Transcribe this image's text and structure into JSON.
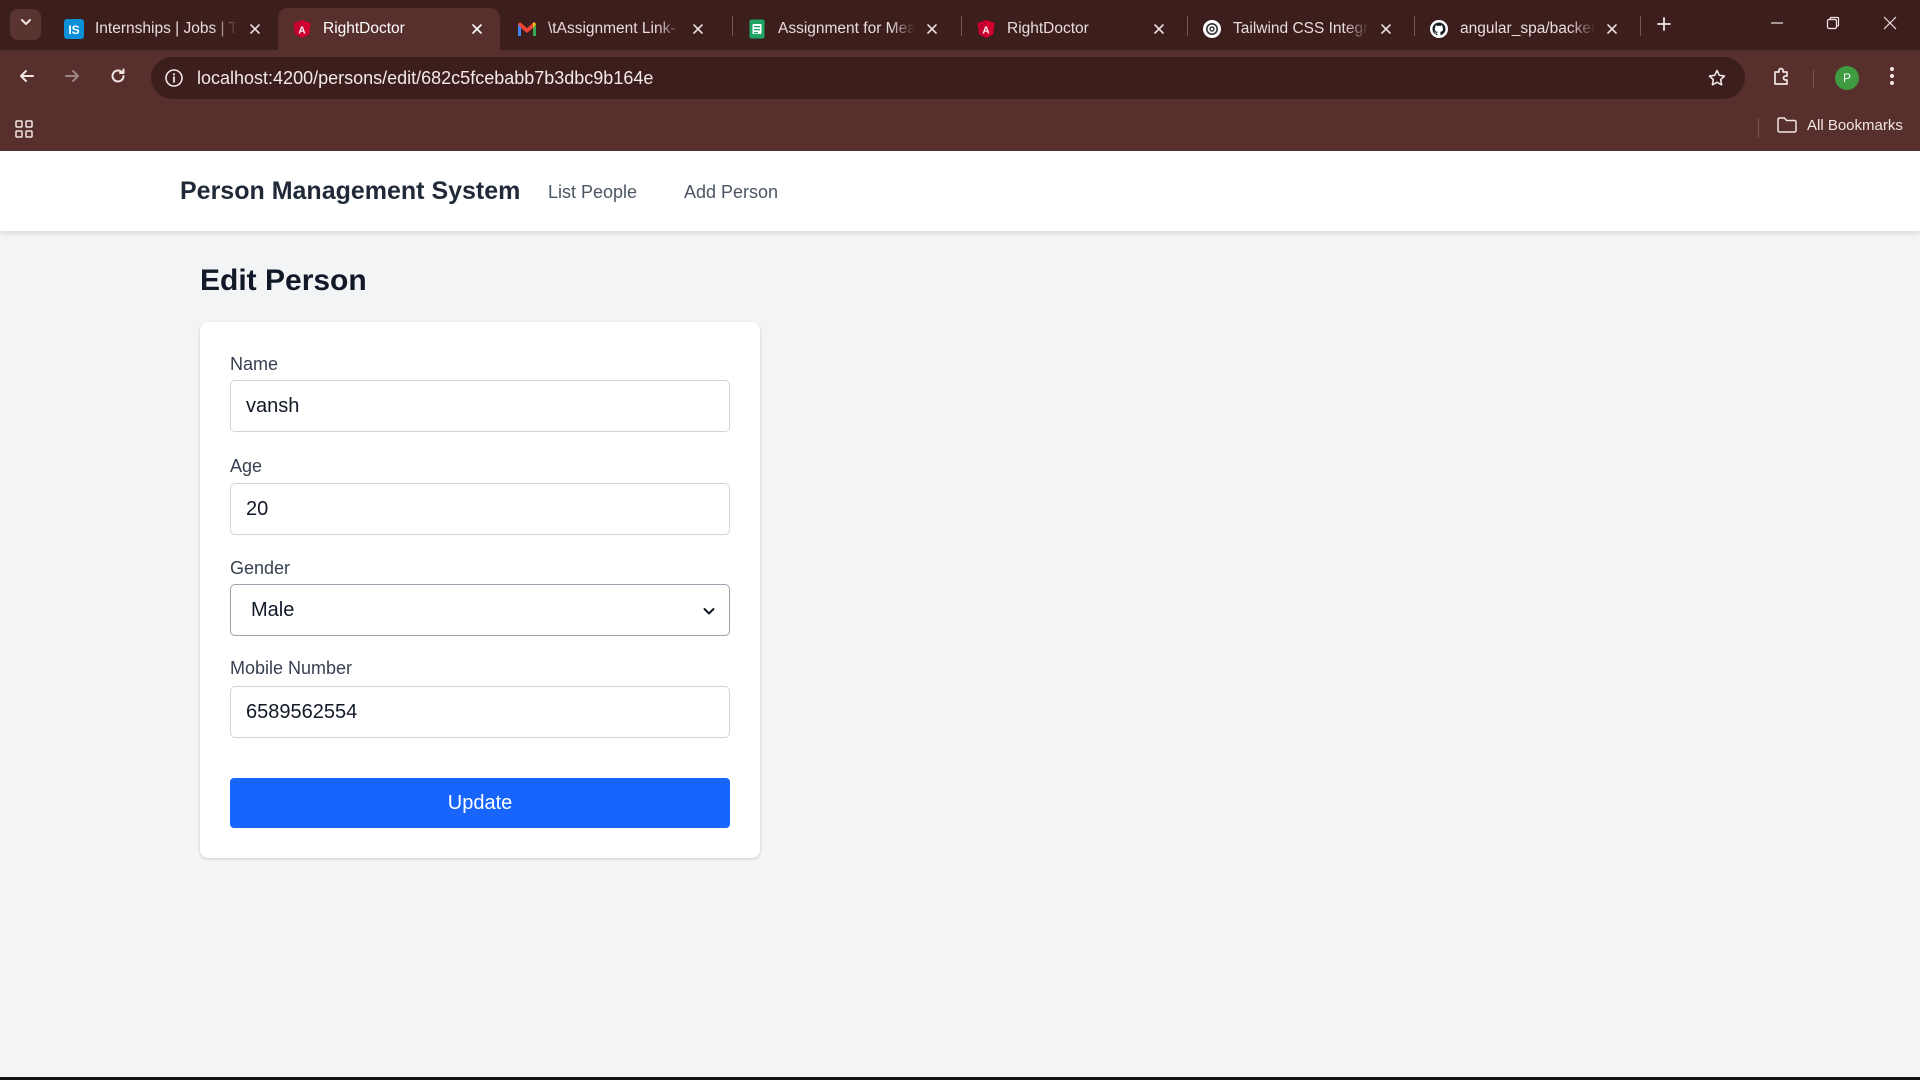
{
  "browser": {
    "tabs": [
      {
        "title": "Internships | Jobs | Training",
        "favicon": "internshala-icon",
        "active": false
      },
      {
        "title": "RightDoctor",
        "favicon": "angular-icon",
        "active": true
      },
      {
        "title": "\\tAssignment Link- MEAN",
        "favicon": "gmail-icon",
        "active": false
      },
      {
        "title": "Assignment for Mean",
        "favicon": "google-forms-icon",
        "active": false
      },
      {
        "title": "RightDoctor",
        "favicon": "angular-icon",
        "active": false
      },
      {
        "title": "Tailwind CSS Integration",
        "favicon": "openai-icon",
        "active": false
      },
      {
        "title": "angular_spa/backend",
        "favicon": "github-icon",
        "active": false
      }
    ],
    "url": "localhost:4200/persons/edit/682c5fcebabb7b3dbc9b164e",
    "profile_initial": "P",
    "bookmarks_label": "All Bookmarks"
  },
  "app": {
    "brand": "Person Management System",
    "nav": [
      "List People",
      "Add Person"
    ]
  },
  "form": {
    "title": "Edit Person",
    "name_label": "Name",
    "name_value": "vansh",
    "age_label": "Age",
    "age_value": "20",
    "gender_label": "Gender",
    "gender_value": "Male",
    "mobile_label": "Mobile Number",
    "mobile_value": "6589562554",
    "submit_label": "Update"
  },
  "colors": {
    "chrome_dark": "#3c1f1d",
    "chrome": "#57302d",
    "page_bg": "#f3f4f6",
    "primary_button": "#1765fc"
  }
}
